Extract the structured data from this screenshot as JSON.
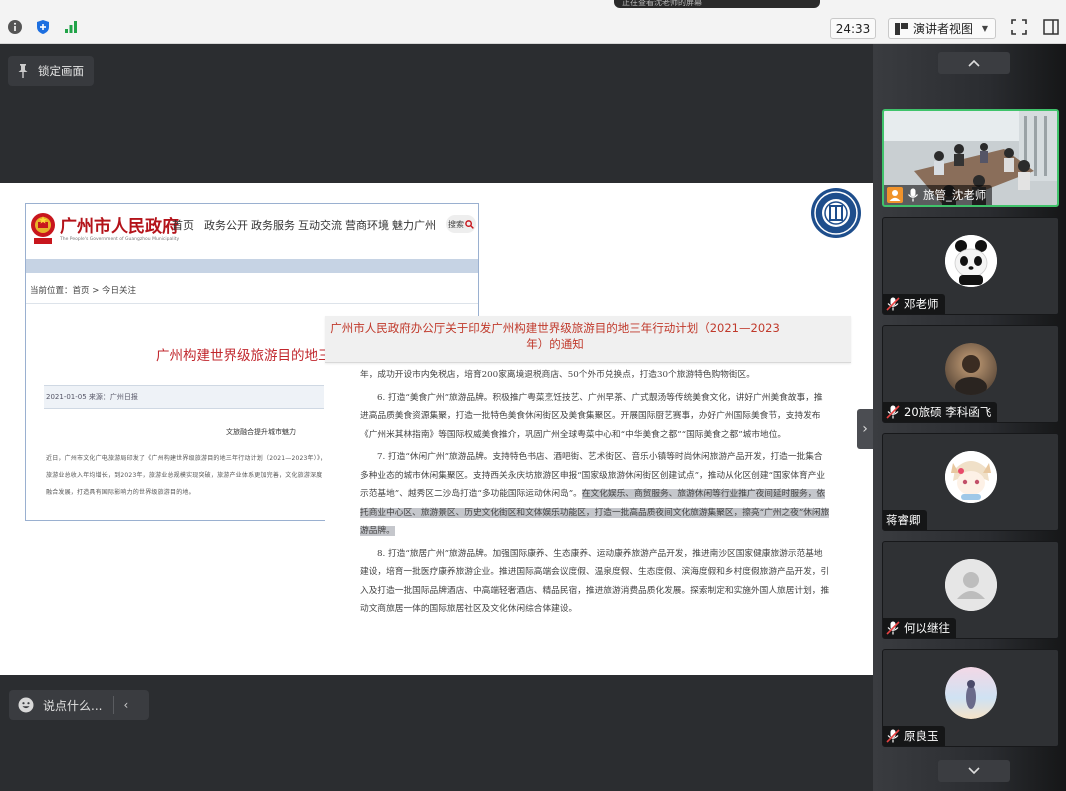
{
  "topbar": {
    "share_title": "正在查看沈老师的屏幕",
    "timer": "24:33",
    "presenter_view": "演讲者视图"
  },
  "main": {
    "lock_label": "锁定画面",
    "chat_placeholder": "说点什么..."
  },
  "slide": {
    "gov_site": {
      "name": "广州市人民政府",
      "name_en": "The People's Government of Guangzhou Municipality",
      "nav": [
        "首页",
        "政务公开",
        "政务服务",
        "互动交流",
        "营商环境",
        "魅力广州"
      ],
      "search": "搜索",
      "breadcrumb": "当前位置：首页 > 今日关注",
      "article_title": "广州构建世界级旅游目的地三年行动",
      "meta": "2021-01-05  来源：广州日报",
      "subtitle": "文旅融合提升城市魅力",
      "body": "近日，广州市文化广电旅游局印发了《广州构建世界级旅游目的地三年行动计划（2021—2023年）》，旅游业总收入年均增长，到2023年，旅游业总规模实现突破，旅游产业体系更加完善，文化旅游深度融合发展，打造具有国际影响力的世界级旅游目的地。"
    },
    "notice": {
      "title_line1": "广州市人民政府办公厅关于印发广州构建世界级旅游目的地三年行动计划（2021—2023",
      "title_line2": "年）的通知",
      "para0": "年，成功开设市内免税店，培育200家离境退税商店、50个外币兑换点，打造30个旅游特色购物街区。",
      "para6": "6. 打造“美食广州”旅游品牌。积极推广粤菜烹饪技艺、广州早茶、广式靓汤等传统美食文化，讲好广州美食故事，推进高品质美食资源集聚，打造一批特色美食休闲街区及美食集聚区。开展国际厨艺赛事，办好广州国际美食节，支持发布《广州米其林指南》等国际权威美食推介，巩固广州全球粤菜中心和“中华美食之都”“国际美食之都”城市地位。",
      "para7_plain": "7. 打造“休闲广州”旅游品牌。支持特色书店、酒吧街、艺术街区、音乐小镇等时尚休闲旅游产品开发，打造一批集合多种业态的城市休闲集聚区。支持西关永庆坊旅游区申报“国家级旅游休闲街区创建试点”，推动从化区创建“国家体育产业示范基地”、越秀区二沙岛打造“多功能国际运动休闲岛”。",
      "para7_highlight": "在文化娱乐、商贸服务、旅游休闲等行业推广夜间延时服务，依托商业中心区、旅游景区、历史文化街区和文体娱乐功能区，打造一批高品质夜间文化旅游集聚区，擦亮“广州之夜”休闲旅游品牌。",
      "para8": "8. 打造“旅居广州”旅游品牌。加强国际康养、生态康养、运动康养旅游产品开发，推进南沙区国家健康旅游示范基地建设，培育一批医疗康养旅游企业。推进国际高端会议度假、温泉度假、生态度假、滨海度假和乡村度假旅游产品开发，引入及打造一批国际品牌酒店、中高端轻奢酒店、精品民宿，推进旅游消费品质化发展。探索制定和实施外国人旅居计划，推动文商旅居一体的国际旅居社区及文化休闲综合体建设。"
    }
  },
  "participants": [
    {
      "name": "旅管_沈老师",
      "active": true,
      "muted": false
    },
    {
      "name": "邓老师",
      "active": false,
      "muted": true
    },
    {
      "name": "20旅硕 李科函飞",
      "active": false,
      "muted": true
    },
    {
      "name": "蒋睿卿",
      "active": false,
      "muted": false
    },
    {
      "name": "何以继往",
      "active": false,
      "muted": true
    },
    {
      "name": "原良玉",
      "active": false,
      "muted": true
    }
  ],
  "colors": {
    "accent_green": "#40c36b",
    "gov_red": "#b4131a",
    "notice_title_red": "#c0392b",
    "panel_bg": "#2b2d30"
  }
}
